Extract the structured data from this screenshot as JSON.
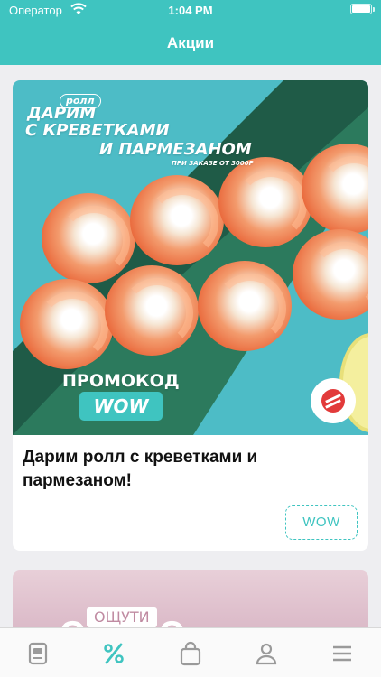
{
  "status_bar": {
    "carrier": "Оператор",
    "time": "1:04 PM"
  },
  "header": {
    "title": "Акции"
  },
  "promo_card": {
    "banner": {
      "tag": "ролл",
      "line1": "дарим",
      "line2": "с креветками",
      "line3": "и пармезаном",
      "note": "при заказе от 3000р",
      "promo_label": "промокод",
      "code": "WOW"
    },
    "title": "Дарим ролл  с креветками и пармезаном!",
    "code_button": "WOW"
  },
  "next_card": {
    "tag": "ОЩУТИ",
    "headline": "ОСТРО"
  },
  "tab_bar": {
    "items": [
      {
        "icon": "menu-card-icon"
      },
      {
        "icon": "percent-icon",
        "active": true
      },
      {
        "icon": "bag-icon"
      },
      {
        "icon": "profile-icon"
      },
      {
        "icon": "hamburger-icon"
      }
    ]
  },
  "colors": {
    "accent": "#3fc4c0",
    "inactive_icon": "#9a9a9a",
    "background": "#eeeef1"
  }
}
